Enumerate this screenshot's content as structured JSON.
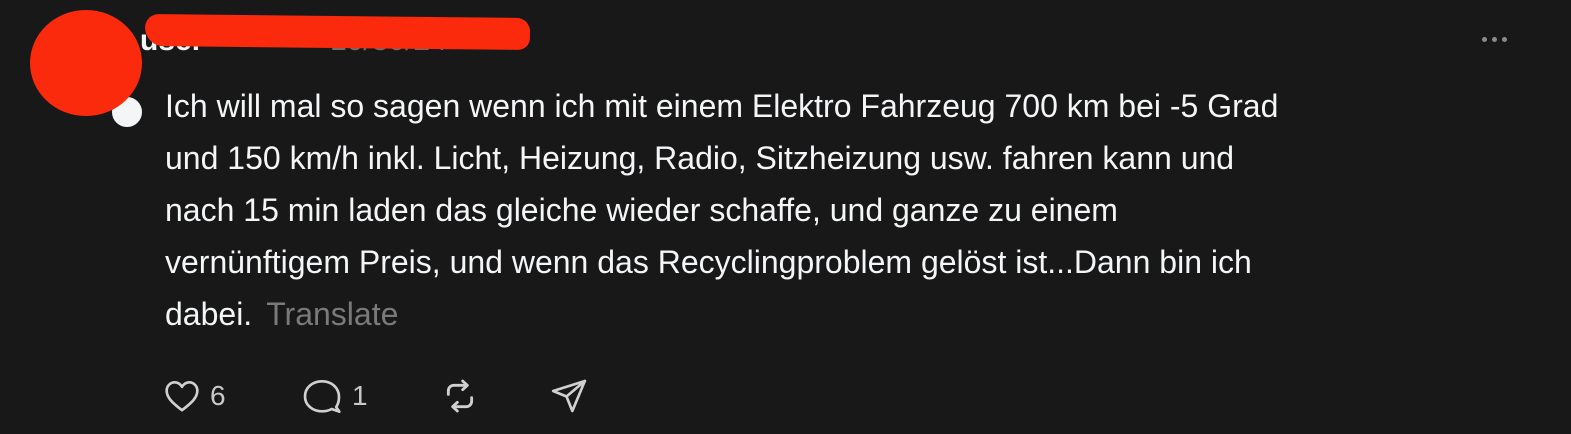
{
  "post": {
    "username": "user",
    "timestamp": "10/30/24",
    "text": "Ich will mal so sagen wenn ich mit einem Elektro Fahrzeug 700 km bei -5 Grad\nund 150 km/h inkl. Licht, Heizung, Radio, Sitzheizung usw. fahren kann und\nnach 15 min laden das gleiche wieder schaffe, und ganze zu einem\nvernünftigem Preis, und wenn das Recyclingproblem gelöst ist...Dann bin ich\ndabei.",
    "translate_label": "Translate"
  },
  "actions": {
    "like_count": "6",
    "reply_count": "1"
  },
  "icons": {
    "more": "more-horizontal-icon",
    "like": "heart-icon",
    "reply": "comment-icon",
    "repost": "repost-icon",
    "share": "send-icon"
  },
  "colors": {
    "background": "#181818",
    "text": "#f3f5f7",
    "muted": "#7a7a7a",
    "redaction": "#fc2a0c"
  }
}
